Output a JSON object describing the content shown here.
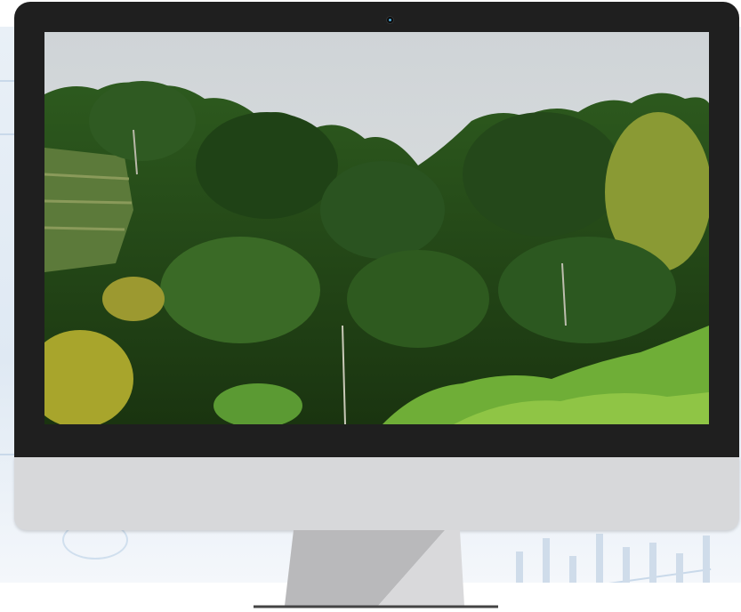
{
  "scene": {
    "description_icon": "forest-landscape-photo",
    "colors": {
      "monitor_bezel": "#1f1f1f",
      "monitor_chin": "#d7d8da",
      "stand": "#b9b9bb",
      "sky": "#d6dadd",
      "foliage_dark": "#1f3a17",
      "foliage_mid": "#3f7a28",
      "foliage_light": "#7fb43a",
      "foliage_yellow": "#b5b23a"
    }
  }
}
